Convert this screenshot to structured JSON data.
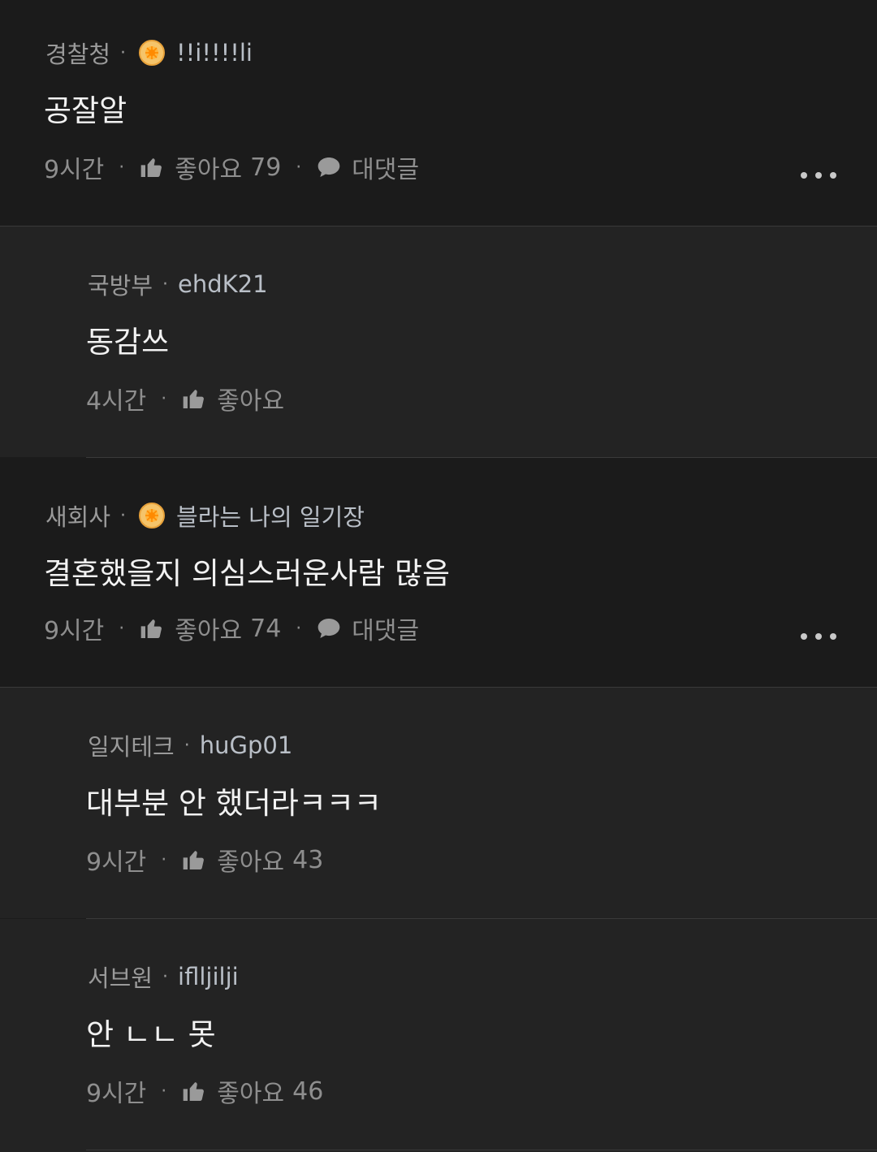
{
  "comments": [
    {
      "org": "경찰청",
      "user": "!!i!!!!li",
      "has_badge": true,
      "text": "공잘알",
      "time": "9시간",
      "like_label": "좋아요",
      "like_count": "79",
      "reply_label": "대댓글"
    },
    {
      "org": "국방부",
      "user": "ehdK21",
      "has_badge": false,
      "text": "동감쓰",
      "time": "4시간",
      "like_label": "좋아요",
      "like_count": ""
    },
    {
      "org": "새회사",
      "user": "블라는 나의 일기장",
      "has_badge": true,
      "text": "결혼했을지 의심스러운사람 많음",
      "time": "9시간",
      "like_label": "좋아요",
      "like_count": "74",
      "reply_label": "대댓글"
    },
    {
      "org": "일지테크",
      "user": "huGp01",
      "has_badge": false,
      "text": "대부분 안 했더라ㅋㅋㅋ",
      "time": "9시간",
      "like_label": "좋아요",
      "like_count": "43"
    },
    {
      "org": "서브원",
      "user": "iflljilji",
      "has_badge": false,
      "text": "안 ㄴㄴ 못",
      "time": "9시간",
      "like_label": "좋아요",
      "like_count": "46"
    }
  ],
  "separator": "·",
  "icons": {
    "badge": "orange-badge-icon",
    "like": "thumbs-up-icon",
    "reply": "speech-bubble-icon",
    "more": "more-dots-icon"
  },
  "colors": {
    "background": "#1b1b1b",
    "reply_background": "#232323",
    "badge": "#f5b942"
  }
}
